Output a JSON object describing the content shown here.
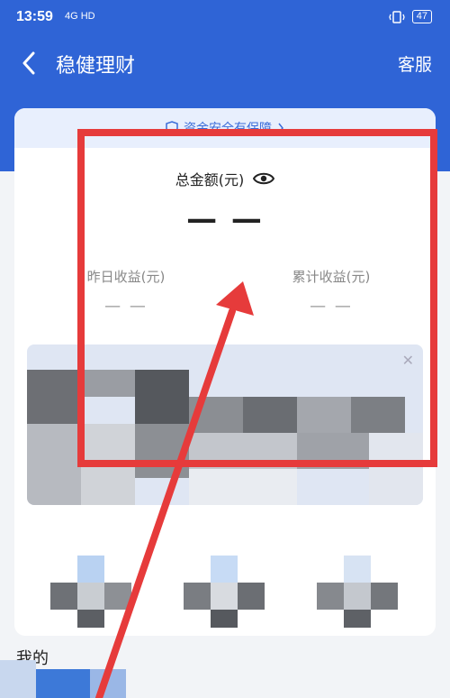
{
  "status_bar": {
    "time": "13:59",
    "network": "4G HD",
    "battery": "47"
  },
  "header": {
    "title": "稳健理财",
    "service": "客服"
  },
  "card": {
    "safety_banner": "资金安全有保障",
    "total_label": "总金额(元)",
    "total_value": "— —",
    "yesterday_label": "昨日收益(元)",
    "yesterday_value": "— —",
    "cumulative_label": "累计收益(元)",
    "cumulative_value": "— —"
  },
  "section": {
    "title": "我的"
  },
  "colors": {
    "header_blue": "#2f64d6",
    "annotation_red": "#e63b3b"
  }
}
